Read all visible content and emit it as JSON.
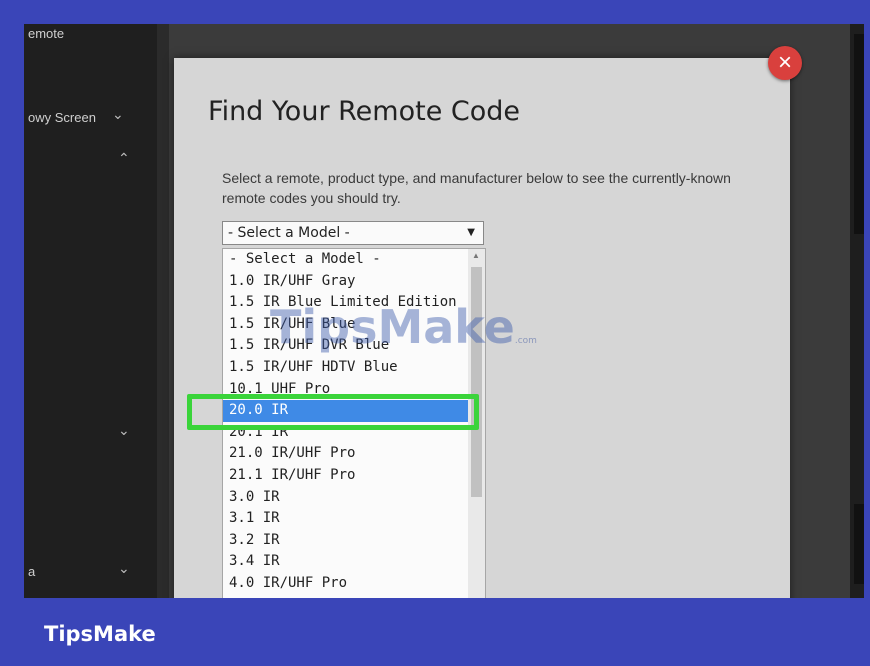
{
  "sidebar": {
    "items": [
      {
        "label": "emote",
        "chevron": ""
      },
      {
        "label": "owy Screen",
        "chevron": "⌄"
      },
      {
        "label": "",
        "chevron": "⌃"
      },
      {
        "label": "",
        "chevron": "⌄"
      },
      {
        "label": "a",
        "chevron": "⌄"
      }
    ]
  },
  "modal": {
    "title": "Find Your Remote Code",
    "description": "Select a remote, product type, and manufacturer below to see the currently-known remote codes you should try.",
    "close_glyph": "×"
  },
  "model_select": {
    "value": "- Select a Model -",
    "arrow_glyph": "▼",
    "options": [
      "- Select a Model -",
      "1.0 IR/UHF Gray",
      "1.5 IR Blue Limited Edition",
      "1.5 IR/UHF Blue",
      "1.5 IR/UHF DVR Blue",
      "1.5 IR/UHF HDTV Blue",
      "10.1 UHF Pro",
      "20.0 IR",
      "20.1 IR",
      "21.0 IR/UHF Pro",
      "21.1 IR/UHF Pro",
      "3.0 IR",
      "3.1 IR",
      "3.2 IR",
      "3.4 IR",
      "4.0 IR/UHF Pro"
    ],
    "highlighted": "20.0 IR"
  },
  "watermark": {
    "text": "TipsMake",
    "suffix": ".com"
  },
  "footer": {
    "brand": "TipsMake"
  },
  "colors": {
    "frame": "#3a45b8",
    "selection": "#3f8ae6",
    "highlight_box": "#3ad43a",
    "close_button": "#d9403d"
  }
}
